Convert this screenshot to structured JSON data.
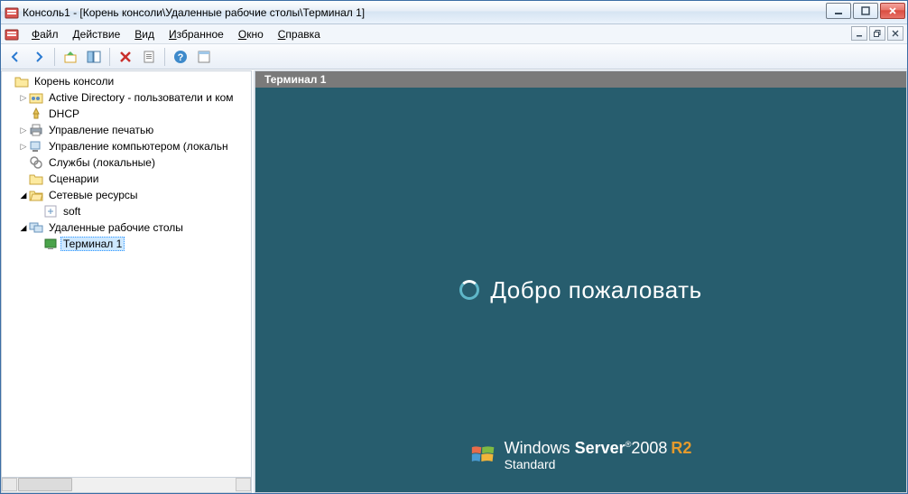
{
  "window": {
    "title": "Консоль1 - [Корень консоли\\Удаленные рабочие столы\\Терминал 1]"
  },
  "menu": {
    "file": "Файл",
    "action": "Действие",
    "view": "Вид",
    "favorites": "Избранное",
    "window": "Окно",
    "help": "Справка"
  },
  "toolbar": {
    "back": "Назад",
    "forward": "Вперед",
    "up": "Вверх",
    "show_hide": "Показать/скрыть",
    "delete": "Удалить",
    "export": "Экспорт",
    "help": "Справка",
    "props": "Свойства"
  },
  "tree": {
    "root": "Корень консоли",
    "items": [
      {
        "label": "Active Directory - пользователи и ком",
        "icon": "ad"
      },
      {
        "label": "DHCP",
        "icon": "dhcp"
      },
      {
        "label": "Управление печатью",
        "icon": "print"
      },
      {
        "label": "Управление компьютером (локальн",
        "icon": "compmgmt"
      },
      {
        "label": "Службы (локальные)",
        "icon": "services"
      },
      {
        "label": "Сценарии",
        "icon": "folder"
      }
    ],
    "network": {
      "label": "Сетевые ресурсы",
      "children": [
        {
          "label": "soft",
          "icon": "share"
        }
      ]
    },
    "rdp": {
      "label": "Удаленные рабочие столы",
      "children": [
        {
          "label": "Терминал 1",
          "icon": "rdp",
          "selected": true
        }
      ]
    }
  },
  "content": {
    "header": "Терминал 1",
    "welcome": "Добро пожаловать",
    "brand_prefix": "Windows",
    "brand_server": "Server",
    "brand_year": "2008",
    "brand_r2": "R2",
    "brand_edition": "Standard"
  }
}
